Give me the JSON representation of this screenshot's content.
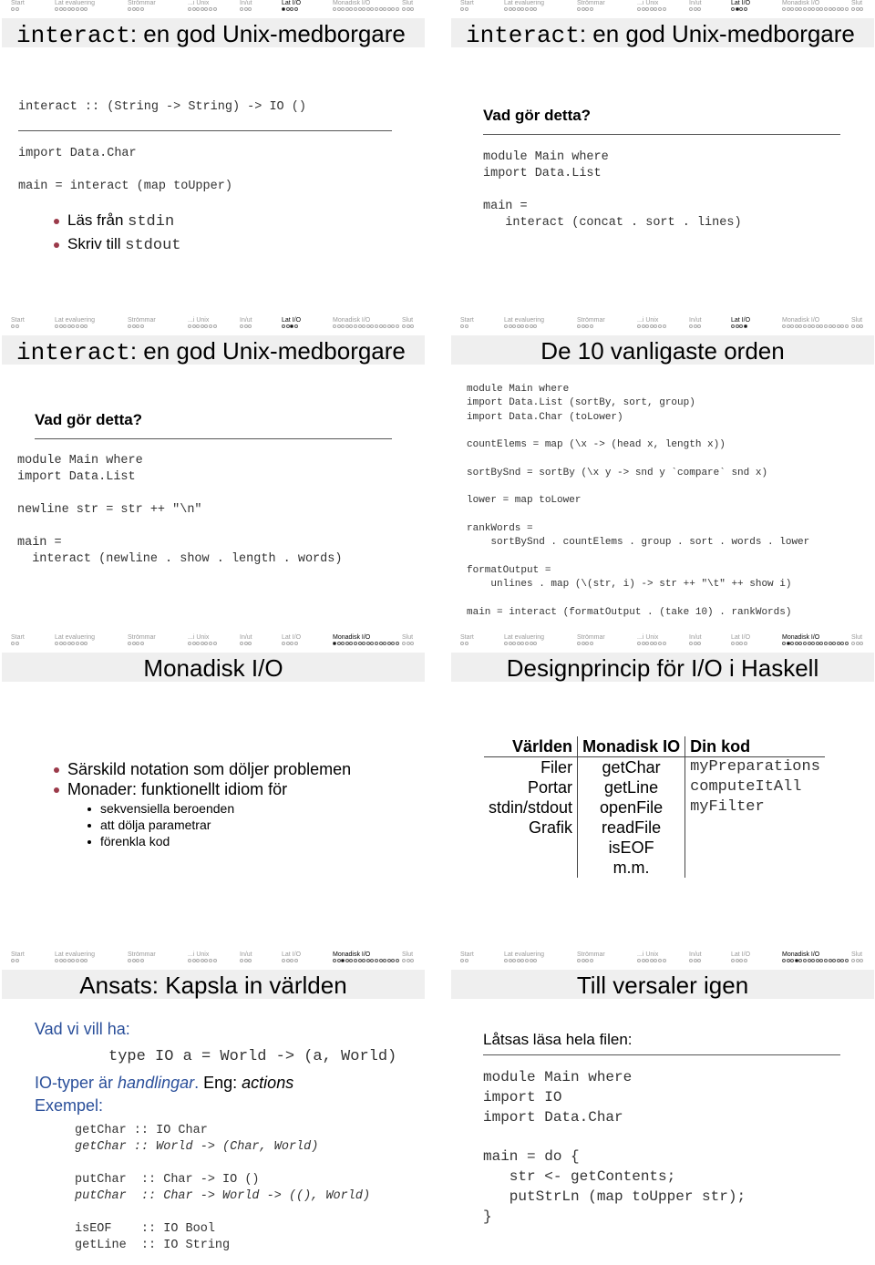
{
  "nav": {
    "sections": [
      {
        "label": "Start",
        "dots": 2
      },
      {
        "label": "Lat evaluering",
        "dots": 8
      },
      {
        "label": "Strömmar",
        "dots": 4
      },
      {
        "label": "...i Unix",
        "dots": 7
      },
      {
        "label": "In/ut",
        "dots": 3
      },
      {
        "label": "Lat I/O",
        "dots": 4
      },
      {
        "label": "Monadisk I/O",
        "dots": 16
      },
      {
        "label": "Slut",
        "dots": 3
      }
    ]
  },
  "slides": [
    {
      "nav_current_section": 5,
      "nav_current_dot": 0,
      "title_code": "interact",
      "title_rest": ": en god Unix-medborgare",
      "signature": "interact :: (String -> String) -> IO ()",
      "code": "import Data.Char\n\nmain = interact (map toUpper)",
      "bullets": [
        {
          "text": "Läs från ",
          "code": "stdin"
        },
        {
          "text": "Skriv till ",
          "code": "stdout"
        }
      ]
    },
    {
      "nav_current_section": 5,
      "nav_current_dot": 1,
      "title_code": "interact",
      "title_rest": ": en god Unix-medborgare",
      "heading": "Vad gör detta?",
      "code": "module Main where\nimport Data.List\n\nmain =\n   interact (concat . sort . lines)"
    },
    {
      "nav_current_section": 5,
      "nav_current_dot": 2,
      "title_code": "interact",
      "title_rest": ": en god Unix-medborgare",
      "heading": "Vad gör detta?",
      "code": "module Main where\nimport Data.List\n\nnewline str = str ++ \"\\n\"\n\nmain =\n  interact (newline . show . length . words)"
    },
    {
      "nav_current_section": 5,
      "nav_current_dot": 3,
      "title": "De 10 vanligaste orden",
      "code": "module Main where\nimport Data.List (sortBy, sort, group)\nimport Data.Char (toLower)\n\ncountElems = map (\\x -> (head x, length x))\n\nsortBySnd = sortBy (\\x y -> snd y `compare` snd x)\n\nlower = map toLower\n\nrankWords =\n    sortBySnd . countElems . group . sort . words . lower\n\nformatOutput =\n    unlines . map (\\(str, i) -> str ++ \"\\t\" ++ show i)\n\nmain = interact (formatOutput . (take 10) . rankWords)"
    },
    {
      "nav_current_section": 6,
      "nav_current_dot": 0,
      "title": "Monadisk I/O",
      "bullets": [
        "Särskild notation som döljer problemen",
        "Monader: funktionellt idiom för"
      ],
      "sub_bullets": [
        "sekvensiella beroenden",
        "att dölja parametrar",
        "förenkla kod"
      ]
    },
    {
      "nav_current_section": 6,
      "nav_current_dot": 1,
      "title": "Designprincip för I/O i Haskell",
      "table": {
        "headers": [
          "Världen",
          "Monadisk IO",
          "Din kod"
        ],
        "col1": [
          "Filer",
          "Portar",
          "stdin/stdout",
          "Grafik"
        ],
        "col2": [
          "getChar",
          "getLine",
          "openFile",
          "readFile",
          "isEOF",
          "m.m."
        ],
        "col3": [
          "myPreparations",
          "computeItAll",
          "myFilter"
        ]
      }
    },
    {
      "nav_current_section": 6,
      "nav_current_dot": 2,
      "title": "Ansats: Kapsla in världen",
      "want": "Vad vi vill ha:",
      "type_def": "type IO a = World -> (a, World)",
      "io_prefix": "IO-typer är ",
      "io_italic": "handlingar",
      "io_dot": ".",
      "eng_label": "Eng: ",
      "eng_italic": "actions",
      "example": "Exempel:",
      "examples": [
        {
          "code": "getChar :: IO Char",
          "italic": false
        },
        {
          "code": "getChar :: World -> (Char, World)",
          "italic": true
        },
        {
          "code": "",
          "italic": false
        },
        {
          "code": "putChar  :: Char -> IO ()",
          "italic": false
        },
        {
          "code": "putChar  :: Char -> World -> ((), World)",
          "italic": true
        },
        {
          "code": "",
          "italic": false
        },
        {
          "code": "isEOF    :: IO Bool",
          "italic": false
        },
        {
          "code": "getLine  :: IO String",
          "italic": false
        }
      ]
    },
    {
      "nav_current_section": 6,
      "nav_current_dot": 3,
      "title": "Till versaler igen",
      "heading": "Låtsas läsa hela filen:",
      "code": "module Main where\nimport IO\nimport Data.Char\n\nmain = do {\n   str <- getContents;\n   putStrLn (map toUpper str);\n}"
    }
  ]
}
